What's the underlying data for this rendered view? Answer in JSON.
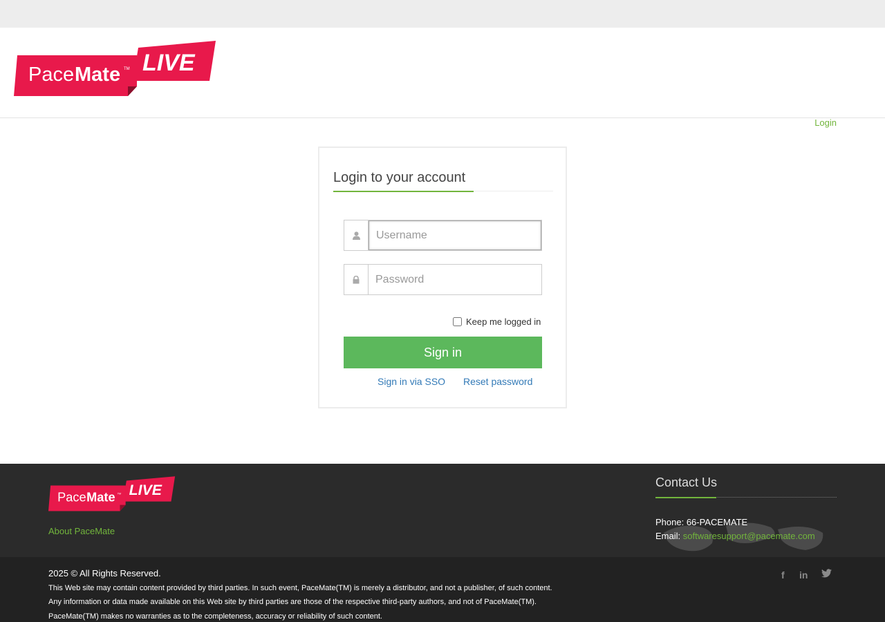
{
  "header": {
    "logo": {
      "brand_pace": "Pace",
      "brand_mate": "Mate",
      "tm": "TM",
      "live": "LIVE"
    }
  },
  "nav": {
    "login_label": "Login"
  },
  "login": {
    "title": "Login to your account",
    "username_placeholder": "Username",
    "password_placeholder": "Password",
    "keep_logged_in_label": "Keep me logged in",
    "sign_in_label": "Sign in",
    "sso_link": "Sign in via SSO",
    "reset_link": "Reset password"
  },
  "footer": {
    "logo": {
      "brand_pace": "Pace",
      "brand_mate": "Mate",
      "tm": "TM",
      "live": "LIVE"
    },
    "about_link": "About PaceMate",
    "contact_title": "Contact Us",
    "phone_label": "Phone: 66-PACEMATE",
    "email_label": "Email: ",
    "email_value": "softwaresupport@pacemate.com",
    "copyright": "2025 © All Rights Reserved.",
    "disclaimer": [
      "This Web site may contain content provided by third parties. In such event, PaceMate(TM) is merely a distributor, and not a publisher, of such content.",
      "Any information or data made available on this Web site by third parties are those of the respective third-party authors, and not of PaceMate(TM).",
      "PaceMate(TM) makes no warranties as to the completeness, accuracy or reliability of such content."
    ],
    "social_icons": [
      "facebook-icon",
      "linkedin-icon",
      "twitter-icon"
    ],
    "social_glyphs": {
      "facebook": "f",
      "linkedin": "in"
    }
  },
  "colors": {
    "brand_red": "#e8194b",
    "accent_green": "#72b53c",
    "button_green": "#5cb85c",
    "link_blue": "#337ab7",
    "footer_bg": "#2b2b2b"
  }
}
